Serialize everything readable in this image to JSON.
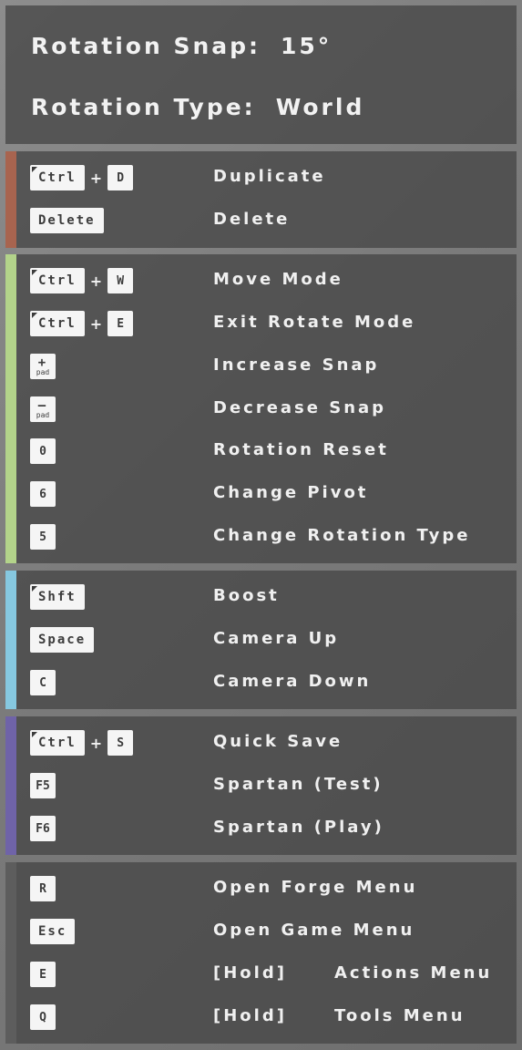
{
  "header": {
    "snap_label": "Rotation Snap:",
    "snap_value": "15°",
    "type_label": "Rotation Type:",
    "type_value": "World"
  },
  "colors": {
    "group1": "#a8644f",
    "group2": "#b3d38a",
    "group3": "#86c8e0",
    "group4": "#6f63a8",
    "group5": "#5d5d5d"
  },
  "icons": {
    "modifier_corner": "modifier-corner-icon",
    "plus": "plus-symbol"
  },
  "groups": [
    {
      "rows": [
        {
          "mod": "Ctrl",
          "key": "D",
          "label": "Duplicate"
        },
        {
          "key": "Delete",
          "label": "Delete"
        }
      ]
    },
    {
      "rows": [
        {
          "mod": "Ctrl",
          "key": "W",
          "label": "Move Mode"
        },
        {
          "mod": "Ctrl",
          "key": "E",
          "label": "Exit Rotate Mode"
        },
        {
          "pad_symbol": "+",
          "pad_sub": "pad",
          "label": "Increase Snap"
        },
        {
          "pad_symbol": "–",
          "pad_sub": "pad",
          "label": "Decrease Snap"
        },
        {
          "key": "0",
          "label": "Rotation Reset"
        },
        {
          "key": "6",
          "label": "Change Pivot"
        },
        {
          "key": "5",
          "label": "Change Rotation Type"
        }
      ]
    },
    {
      "rows": [
        {
          "mod": "Shft",
          "label": "Boost"
        },
        {
          "key": "Space",
          "label": "Camera Up"
        },
        {
          "key": "C",
          "label": "Camera Down"
        }
      ]
    },
    {
      "rows": [
        {
          "mod": "Ctrl",
          "key": "S",
          "label": "Quick Save"
        },
        {
          "key": "F5",
          "label": "Spartan (Test)"
        },
        {
          "key": "F6",
          "label": "Spartan (Play)"
        }
      ]
    },
    {
      "rows": [
        {
          "key": "R",
          "label": "Open Forge Menu"
        },
        {
          "key": "Esc",
          "label": "Open Game Menu"
        },
        {
          "key": "E",
          "prefix": "[Hold]",
          "label": "Actions Menu"
        },
        {
          "key": "Q",
          "prefix": "[Hold]",
          "label": "Tools Menu"
        }
      ]
    }
  ]
}
